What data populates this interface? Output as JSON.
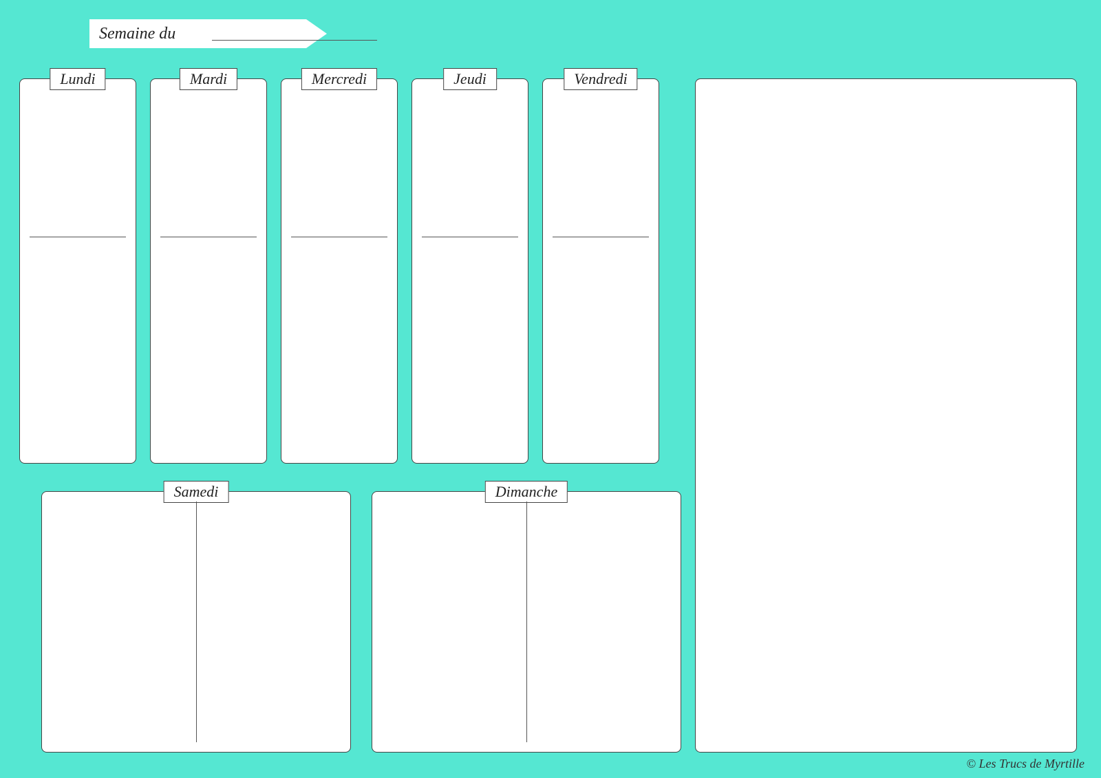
{
  "colors": {
    "background": "#55e7d2",
    "panel": "#ffffff",
    "line": "#555555"
  },
  "header": {
    "label": "Semaine du"
  },
  "days": {
    "mon": "Lundi",
    "tue": "Mardi",
    "wed": "Mercredi",
    "thu": "Jeudi",
    "fri": "Vendredi",
    "sat": "Samedi",
    "sun": "Dimanche"
  },
  "credit": "© Les Trucs de Myrtille"
}
